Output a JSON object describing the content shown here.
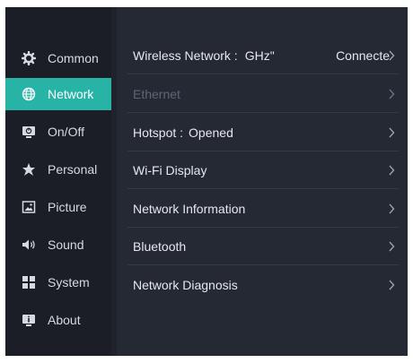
{
  "sidebar": {
    "items": [
      {
        "label": "Common",
        "icon": "gear-icon"
      },
      {
        "label": "Network",
        "icon": "globe-icon"
      },
      {
        "label": "On/Off",
        "icon": "power-monitor-icon"
      },
      {
        "label": "Personal",
        "icon": "star-pin-icon"
      },
      {
        "label": "Picture",
        "icon": "image-icon"
      },
      {
        "label": "Sound",
        "icon": "speaker-icon"
      },
      {
        "label": "System",
        "icon": "system-blocks-icon"
      },
      {
        "label": "About",
        "icon": "info-monitor-icon"
      }
    ],
    "active_index": 1
  },
  "network": {
    "rows": [
      {
        "label": "Wireless Network :",
        "value": "GHz\"",
        "status": "Connecte",
        "enabled": true
      },
      {
        "label": "Ethernet",
        "value": "",
        "status": "",
        "enabled": false
      },
      {
        "label": "Hotspot :",
        "value": "Opened",
        "status": "",
        "enabled": true
      },
      {
        "label": "Wi-Fi Display",
        "value": "",
        "status": "",
        "enabled": true
      },
      {
        "label": "Network Information",
        "value": "",
        "status": "",
        "enabled": true
      },
      {
        "label": "Bluetooth",
        "value": "",
        "status": "",
        "enabled": true
      },
      {
        "label": "Network Diagnosis",
        "value": "",
        "status": "",
        "enabled": true
      }
    ]
  },
  "colors": {
    "accent": "#27b3a6",
    "panel_bg": "#20232c",
    "content_bg": "#252934",
    "text": "#e6e8ee",
    "disabled_text": "#5f6573"
  }
}
